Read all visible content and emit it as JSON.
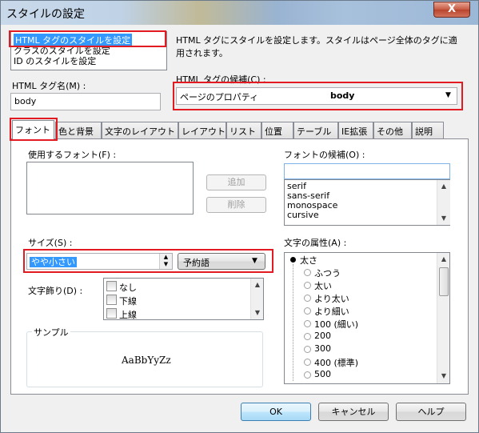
{
  "window": {
    "title": "スタイルの設定",
    "close": "X"
  },
  "style_targets": {
    "items": [
      "HTML タグのスタイルを設定",
      "クラスのスタイルを設定",
      "ID のスタイルを設定"
    ]
  },
  "description": "HTML タグにスタイルを設定します。スタイルはページ全体のタグに適用されます。",
  "tag_name": {
    "label": "HTML タグ名(M) :",
    "value": "body"
  },
  "tag_candidates": {
    "label": "HTML タグの候補(C) :",
    "selected_left": "ページのプロパティ",
    "selected_right": "body"
  },
  "tabs": [
    "フォント",
    "色と背景",
    "文字のレイアウト",
    "レイアウト",
    "リスト",
    "位置",
    "テーブル",
    "IE拡張",
    "その他",
    "説明"
  ],
  "font": {
    "used_label": "使用するフォント(F) :",
    "add": "追加",
    "delete": "削除",
    "candidates_label": "フォントの候補(O) :",
    "candidates": [
      "serif",
      "sans-serif",
      "monospace",
      "cursive"
    ]
  },
  "size": {
    "label": "サイズ(S) :",
    "value": "やや小さい",
    "unit": "予約語"
  },
  "decoration": {
    "label": "文字飾り(D) :",
    "items": [
      "なし",
      "下線",
      "上線"
    ]
  },
  "sample": {
    "label": "サンプル",
    "text": "AaBbYyZz"
  },
  "attributes": {
    "label": "文字の属性(A) :",
    "root": "太さ",
    "items": [
      "ふつう",
      "太い",
      "より太い",
      "より細い",
      "100 (細い)",
      "200",
      "300",
      "400 (標準)",
      "500"
    ]
  },
  "footer": {
    "ok": "OK",
    "cancel": "キャンセル",
    "help": "ヘルプ"
  },
  "colors": {
    "selection": "#3399ff",
    "highlight_box": "#e21a22"
  }
}
